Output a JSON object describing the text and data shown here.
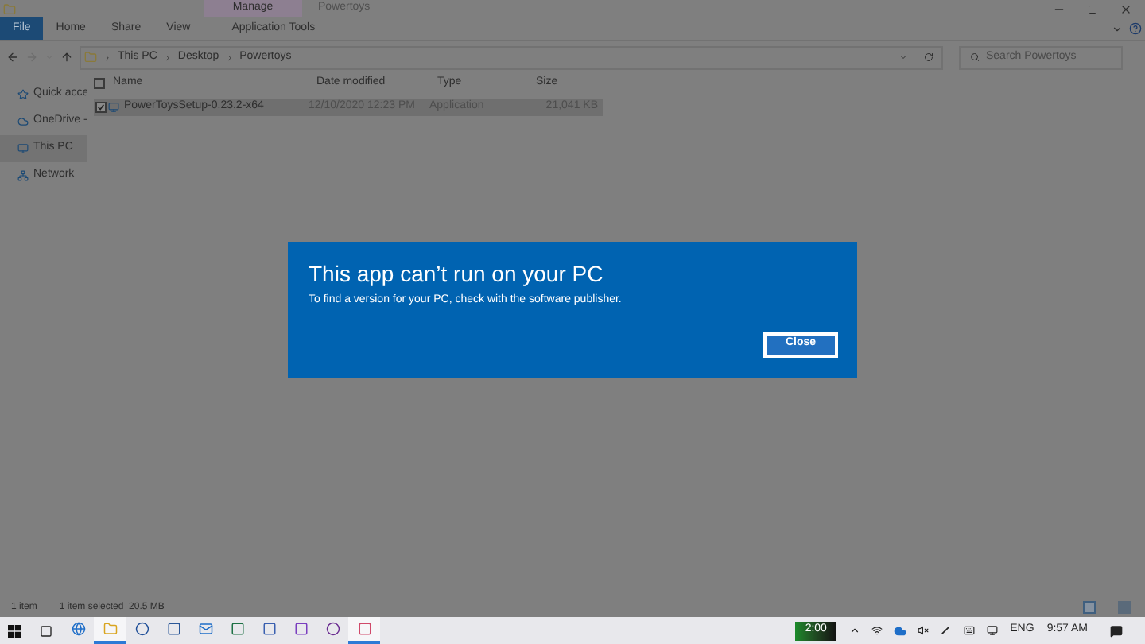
{
  "window": {
    "title": "Powertoys",
    "context_tab": "Manage"
  },
  "ribbon_tabs": [
    {
      "label": "File",
      "kind": "file",
      "selected": false
    },
    {
      "label": "Home",
      "kind": "tab",
      "selected": false
    },
    {
      "label": "Share",
      "kind": "tab",
      "selected": false
    },
    {
      "label": "View",
      "kind": "tab",
      "selected": false
    },
    {
      "label": "Application Tools",
      "kind": "context",
      "selected": false
    }
  ],
  "address": {
    "path": [
      "This PC",
      "Desktop",
      "Powertoys"
    ]
  },
  "search": {
    "placeholder": "Search Powertoys"
  },
  "sidebar": {
    "items": [
      {
        "label": "Quick acce",
        "kind": "star",
        "selected": false
      },
      {
        "label": "OneDrive -",
        "kind": "cloud",
        "selected": false
      },
      {
        "label": "This PC",
        "kind": "pc",
        "selected": true
      },
      {
        "label": "Network",
        "kind": "network",
        "selected": false
      }
    ]
  },
  "table": {
    "all_checked": false,
    "columns": [
      "Name",
      "Date modified",
      "Type",
      "Size"
    ],
    "rows": [
      {
        "name": "PowerToysSetup-0.23.2-x64",
        "date": "12/10/2020 12:23 PM",
        "type": "Application",
        "size": "21,041 KB",
        "selected": true,
        "checked": true
      }
    ]
  },
  "status_bar": {
    "count": "1 item",
    "selection": "1 item selected  20.5 MB"
  },
  "dialog": {
    "title": "This app can’t run on your PC",
    "message": "To find a version for your PC, check with the software publisher.",
    "button": "Close"
  },
  "taskbar": {
    "apps": [
      {
        "kind": "edge",
        "selected": false
      },
      {
        "kind": "explorer",
        "selected": true
      },
      {
        "kind": "ring",
        "selected": false
      },
      {
        "kind": "doc",
        "selected": false
      },
      {
        "kind": "mail",
        "selected": false
      },
      {
        "kind": "sheet",
        "selected": false
      },
      {
        "kind": "calendar",
        "selected": false
      },
      {
        "kind": "code",
        "selected": false
      },
      {
        "kind": "ring2",
        "selected": false
      },
      {
        "kind": "snip",
        "selected": true
      }
    ],
    "battery": "2:00",
    "language": "ENG",
    "time": "9:57 AM"
  }
}
